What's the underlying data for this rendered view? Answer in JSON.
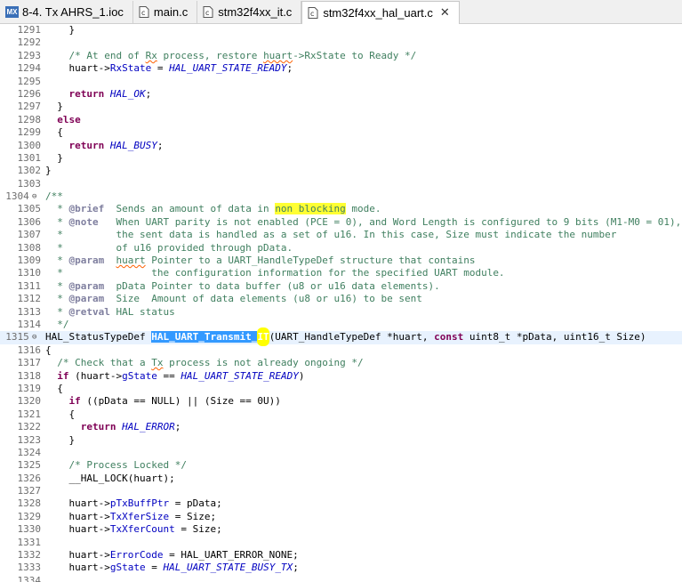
{
  "tabs": [
    {
      "label": "8-4. Tx AHRS_1.ioc",
      "icon": "mx-icon",
      "badge": "MX"
    },
    {
      "label": "main.c",
      "icon": "c-file-icon"
    },
    {
      "label": "stm32f4xx_it.c",
      "icon": "c-file-icon"
    },
    {
      "label": "stm32f4xx_hal_uart.c",
      "icon": "c-file-icon",
      "active": true
    }
  ],
  "colors": {
    "keyword": "#7f0055",
    "comment": "#3f7f5f",
    "field": "#0000c0",
    "selection": "#3399ff",
    "highlight": "#ffff00"
  },
  "lines": [
    {
      "n": "1291",
      "code": "    }"
    },
    {
      "n": "1292",
      "code": ""
    },
    {
      "n": "1293",
      "code": "    /* At end of Rx process, restore huart->RxState to Ready */"
    },
    {
      "n": "1294",
      "code": "    huart->RxState = HAL_UART_STATE_READY;"
    },
    {
      "n": "1295",
      "code": ""
    },
    {
      "n": "1296",
      "code": "    return HAL_OK;"
    },
    {
      "n": "1297",
      "code": "  }"
    },
    {
      "n": "1298",
      "code": "  else"
    },
    {
      "n": "1299",
      "code": "  {"
    },
    {
      "n": "1300",
      "code": "    return HAL_BUSY;"
    },
    {
      "n": "1301",
      "code": "  }"
    },
    {
      "n": "1302",
      "code": "}"
    },
    {
      "n": "1303",
      "code": ""
    },
    {
      "n": "1304",
      "code": "/**"
    },
    {
      "n": "1305",
      "code": "  * @brief  Sends an amount of data in non blocking mode."
    },
    {
      "n": "1306",
      "code": "  * @note   When UART parity is not enabled (PCE = 0), and Word Length is configured to 9 bits (M1-M0 = 01),"
    },
    {
      "n": "1307",
      "code": "  *         the sent data is handled as a set of u16. In this case, Size must indicate the number"
    },
    {
      "n": "1308",
      "code": "  *         of u16 provided through pData."
    },
    {
      "n": "1309",
      "code": "  * @param  huart Pointer to a UART_HandleTypeDef structure that contains"
    },
    {
      "n": "1310",
      "code": "  *               the configuration information for the specified UART module."
    },
    {
      "n": "1311",
      "code": "  * @param  pData Pointer to data buffer (u8 or u16 data elements)."
    },
    {
      "n": "1312",
      "code": "  * @param  Size  Amount of data elements (u8 or u16) to be sent"
    },
    {
      "n": "1313",
      "code": "  * @retval HAL status"
    },
    {
      "n": "1314",
      "code": "  */"
    },
    {
      "n": "1315",
      "code": "HAL_StatusTypeDef HAL_UART_Transmit_IT(UART_HandleTypeDef *huart, const uint8_t *pData, uint16_t Size)"
    },
    {
      "n": "1316",
      "code": "{"
    },
    {
      "n": "1317",
      "code": "  /* Check that a Tx process is not already ongoing */"
    },
    {
      "n": "1318",
      "code": "  if (huart->gState == HAL_UART_STATE_READY)"
    },
    {
      "n": "1319",
      "code": "  {"
    },
    {
      "n": "1320",
      "code": "    if ((pData == NULL) || (Size == 0U))"
    },
    {
      "n": "1321",
      "code": "    {"
    },
    {
      "n": "1322",
      "code": "      return HAL_ERROR;"
    },
    {
      "n": "1323",
      "code": "    }"
    },
    {
      "n": "1324",
      "code": ""
    },
    {
      "n": "1325",
      "code": "    /* Process Locked */"
    },
    {
      "n": "1326",
      "code": "    __HAL_LOCK(huart);"
    },
    {
      "n": "1327",
      "code": ""
    },
    {
      "n": "1328",
      "code": "    huart->pTxBuffPtr = pData;"
    },
    {
      "n": "1329",
      "code": "    huart->TxXferSize = Size;"
    },
    {
      "n": "1330",
      "code": "    huart->TxXferCount = Size;"
    },
    {
      "n": "1331",
      "code": ""
    },
    {
      "n": "1332",
      "code": "    huart->ErrorCode = HAL_UART_ERROR_NONE;"
    },
    {
      "n": "1333",
      "code": "    huart->gState = HAL_UART_STATE_BUSY_TX;"
    },
    {
      "n": "1334",
      "code": ""
    }
  ]
}
